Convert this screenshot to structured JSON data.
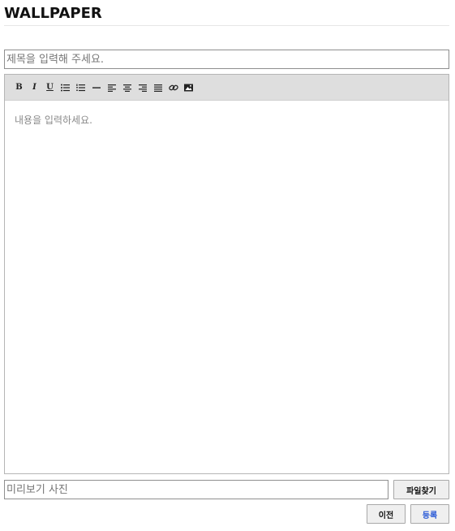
{
  "page": {
    "title": "WALLPAPER"
  },
  "form": {
    "title_placeholder": "제목을 입력해 주세요.",
    "title_value": "",
    "content_placeholder": "내용을 입력하세요.",
    "file_placeholder": "미리보기 사진",
    "file_value": ""
  },
  "toolbar": {
    "bold_label": "B",
    "italic_label": "I",
    "underline_label": "U",
    "icons": [
      "bold-icon",
      "italic-icon",
      "underline-icon",
      "bullet-list-icon",
      "numbered-list-icon",
      "horizontal-rule-icon",
      "align-left-icon",
      "align-center-icon",
      "align-right-icon",
      "align-justify-icon",
      "link-icon",
      "image-icon"
    ]
  },
  "buttons": {
    "find_file": "파일찾기",
    "prev": "이전",
    "submit": "등록"
  },
  "colors": {
    "submit_text": "#2b5bd7",
    "toolbar_bg": "#dedede"
  }
}
